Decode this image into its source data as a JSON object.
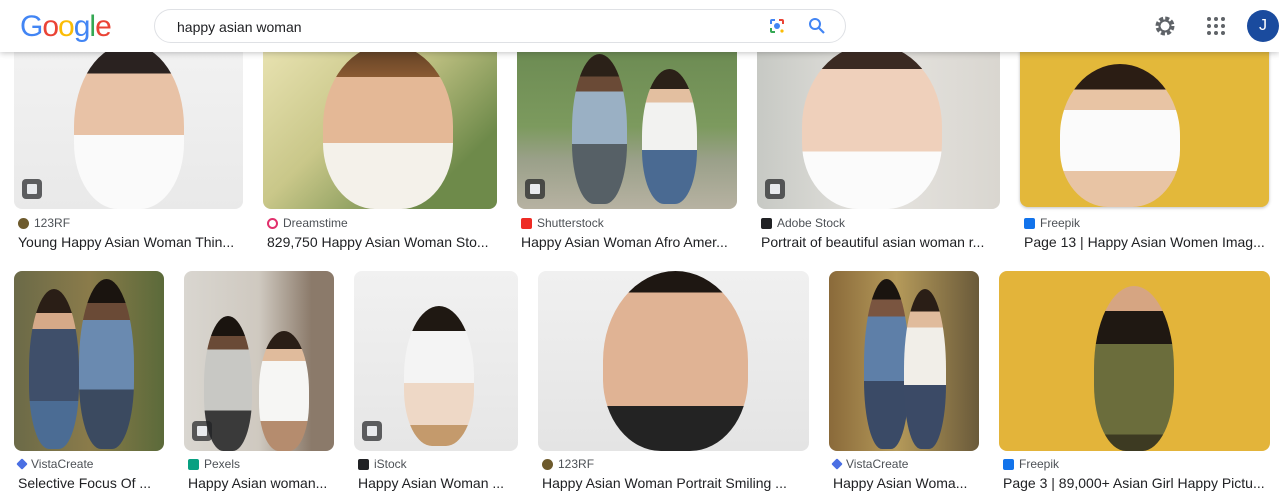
{
  "header": {
    "logo": [
      "G",
      "o",
      "o",
      "g",
      "l",
      "e"
    ],
    "logo_colors": [
      "#4285f4",
      "#ea4335",
      "#fbbc05",
      "#4285f4",
      "#34a853",
      "#ea4335"
    ],
    "search_value": "happy asian woman",
    "avatar_letter": "J"
  },
  "results": [
    {
      "source": "123RF",
      "caption": "Young Happy Asian Woman Thin...",
      "favicon_color": "#5f6368"
    },
    {
      "source": "Dreamstime",
      "caption": "829,750 Happy Asian Woman Sto...",
      "favicon_color": "#e1306c"
    },
    {
      "source": "Shutterstock",
      "caption": "Happy Asian Woman Afro Amer...",
      "favicon_color": "#ee2b24"
    },
    {
      "source": "Adobe Stock",
      "caption": "Portrait of beautiful asian woman r...",
      "favicon_color": "#202124"
    },
    {
      "source": "Freepik",
      "caption": "Page 13 | Happy Asian Women Imag...",
      "favicon_color": "#1273eb"
    },
    {
      "source": "VistaCreate",
      "caption": "Selective Focus Of ...",
      "favicon_color": "#4a6fe3"
    },
    {
      "source": "Pexels",
      "caption": "Happy Asian woman...",
      "favicon_color": "#07a081"
    },
    {
      "source": "iStock",
      "caption": "Happy Asian Woman ...",
      "favicon_color": "#202124"
    },
    {
      "source": "123RF",
      "caption": "Happy Asian Woman Portrait Smiling ...",
      "favicon_color": "#5f6368"
    },
    {
      "source": "VistaCreate",
      "caption": "Happy Asian Woma...",
      "favicon_color": "#4a6fe3"
    },
    {
      "source": "Freepik",
      "caption": "Page 3 | 89,000+ Asian Girl Happy Pictu...",
      "favicon_color": "#1273eb"
    }
  ]
}
